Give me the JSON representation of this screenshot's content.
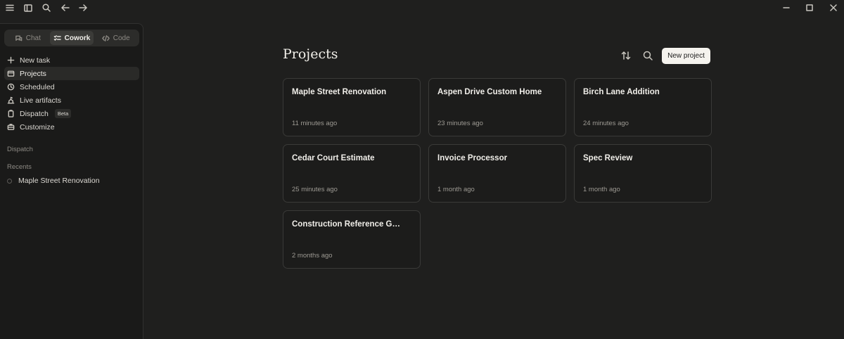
{
  "modes": [
    {
      "label": "Chat",
      "icon": "chat-icon"
    },
    {
      "label": "Cowork",
      "icon": "cowork-icon"
    },
    {
      "label": "Code",
      "icon": "code-icon"
    }
  ],
  "nav": [
    {
      "label": "New task",
      "icon": "plus-icon"
    },
    {
      "label": "Projects",
      "icon": "folder-icon"
    },
    {
      "label": "Scheduled",
      "icon": "clock-icon"
    },
    {
      "label": "Live artifacts",
      "icon": "artifacts-icon"
    },
    {
      "label": "Dispatch",
      "icon": "dispatch-icon",
      "badge": "Beta"
    },
    {
      "label": "Customize",
      "icon": "briefcase-icon"
    }
  ],
  "sections": {
    "dispatch": "Dispatch",
    "recents": "Recents"
  },
  "recents": [
    {
      "label": "Maple Street Renovation"
    }
  ],
  "main": {
    "title": "Projects",
    "new_project_label": "New project"
  },
  "projects": [
    {
      "title": "Maple Street Renovation",
      "time": "11 minutes ago"
    },
    {
      "title": "Aspen Drive Custom Home",
      "time": "23 minutes ago"
    },
    {
      "title": "Birch Lane Addition",
      "time": "24 minutes ago"
    },
    {
      "title": "Cedar Court Estimate",
      "time": "25 minutes ago"
    },
    {
      "title": "Invoice Processor",
      "time": "1 month ago"
    },
    {
      "title": "Spec Review",
      "time": "1 month ago"
    },
    {
      "title": "Construction Reference G…",
      "time": "2 months ago"
    }
  ],
  "colors": {
    "background": "#1f1f1e",
    "sidebar": "#1a1a19",
    "card_border": "#3a3a38",
    "button": "#f5f3ee"
  }
}
